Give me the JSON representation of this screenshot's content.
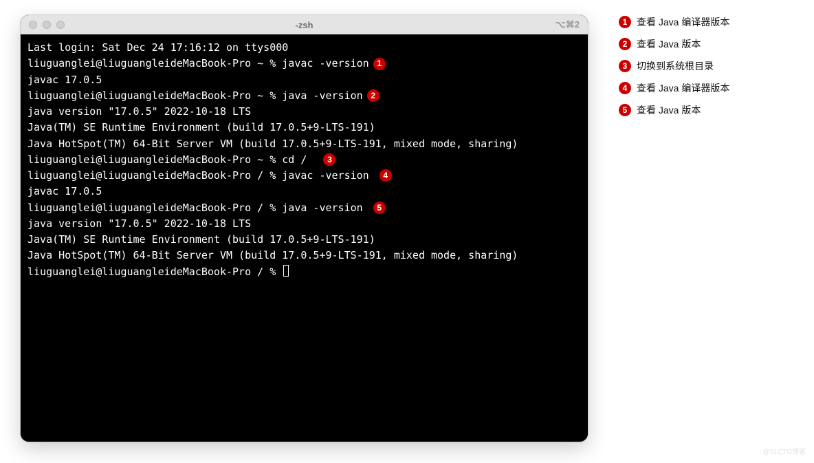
{
  "window": {
    "title": "-zsh",
    "shortcut": "⌥⌘2"
  },
  "terminal": {
    "lines": [
      {
        "text": "Last login: Sat Dec 24 17:16:12 on ttys000"
      },
      {
        "text": "liuguanglei@liuguangleideMacBook-Pro ~ % javac -version",
        "badge": "1"
      },
      {
        "text": "javac 17.0.5"
      },
      {
        "text": "liuguanglei@liuguangleideMacBook-Pro ~ % java -version",
        "badge": "2"
      },
      {
        "text": "java version \"17.0.5\" 2022-10-18 LTS"
      },
      {
        "text": "Java(TM) SE Runtime Environment (build 17.0.5+9-LTS-191)"
      },
      {
        "text": "Java HotSpot(TM) 64-Bit Server VM (build 17.0.5+9-LTS-191, mixed mode, sharing)"
      },
      {
        "text": "liuguanglei@liuguangleideMacBook-Pro ~ % cd /  ",
        "badge": "3"
      },
      {
        "text": "liuguanglei@liuguangleideMacBook-Pro / % javac -version ",
        "badge": "4"
      },
      {
        "text": "javac 17.0.5"
      },
      {
        "text": "liuguanglei@liuguangleideMacBook-Pro / % java -version ",
        "badge": "5"
      },
      {
        "text": "java version \"17.0.5\" 2022-10-18 LTS"
      },
      {
        "text": "Java(TM) SE Runtime Environment (build 17.0.5+9-LTS-191)"
      },
      {
        "text": "Java HotSpot(TM) 64-Bit Server VM (build 17.0.5+9-LTS-191, mixed mode, sharing)"
      },
      {
        "text": "liuguanglei@liuguangleideMacBook-Pro / % ",
        "cursor": true
      }
    ]
  },
  "legend": [
    {
      "num": "1",
      "label": "查看 Java 编译器版本"
    },
    {
      "num": "2",
      "label": "查看 Java 版本"
    },
    {
      "num": "3",
      "label": "切换到系统根目录"
    },
    {
      "num": "4",
      "label": "查看 Java 编译器版本"
    },
    {
      "num": "5",
      "label": "查看 Java 版本"
    }
  ],
  "watermark": "@51CTO博客"
}
